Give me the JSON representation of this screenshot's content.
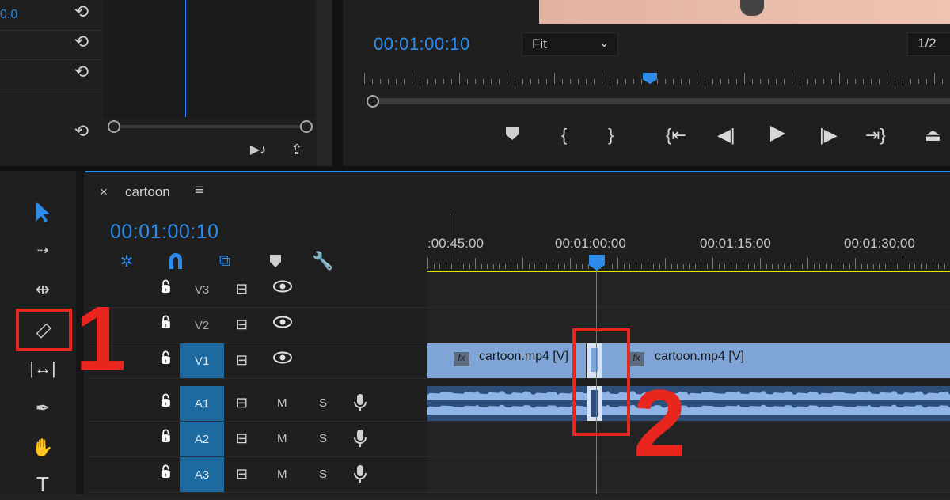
{
  "effect_controls": {
    "value_partial": "0.0",
    "reset_icon": "reset-parameter-icon",
    "bottom_icons": [
      "play-audio-icon",
      "export-frame-icon"
    ]
  },
  "program_monitor": {
    "timecode": "00:01:00:10",
    "zoom_value": "Fit",
    "resolution_value": "1/2",
    "transport_icons": [
      "add-marker-icon",
      "mark-in-icon",
      "mark-out-icon",
      "go-to-in-icon",
      "step-back-icon",
      "play-icon",
      "step-forward-icon",
      "go-to-out-icon",
      "lift-icon"
    ]
  },
  "timeline": {
    "tab_title": "cartoon",
    "close_glyph": "×",
    "menu_glyph": "≡",
    "timecode": "00:01:00:10",
    "ruler_labels": [
      ":00:45:00",
      "00:01:00:00",
      "00:01:15:00",
      "00:01:30:00"
    ],
    "header_icons": [
      "nest-sequence-icon",
      "snap-icon",
      "linked-selection-icon",
      "add-marker-icon",
      "settings-wrench-icon"
    ],
    "tracks": [
      {
        "name": "V3",
        "type": "video",
        "targeted": false
      },
      {
        "name": "V2",
        "type": "video",
        "targeted": false
      },
      {
        "name": "V1",
        "type": "video",
        "targeted": true
      },
      {
        "name": "A1",
        "type": "audio",
        "targeted": true
      },
      {
        "name": "A2",
        "type": "audio",
        "targeted": true
      },
      {
        "name": "A3",
        "type": "audio",
        "targeted": true
      }
    ],
    "mute_label": "M",
    "solo_label": "S",
    "clip_left_label": "cartoon.mp4 [V]",
    "clip_right_label": "cartoon.mp4 [V]",
    "fx_badge": "fx"
  },
  "tools": [
    "selection-tool",
    "track-select-forward-tool",
    "ripple-edit-tool",
    "razor-tool",
    "slip-tool",
    "pen-tool",
    "hand-tool",
    "type-tool"
  ],
  "annotations": {
    "step1": "1",
    "step2": "2",
    "color": "#e8261d"
  },
  "colors": {
    "accent": "#2d8ceb",
    "clip_video": "#7fa4d6",
    "clip_audio": "#2c4e78",
    "work_area": "#e8e000"
  }
}
